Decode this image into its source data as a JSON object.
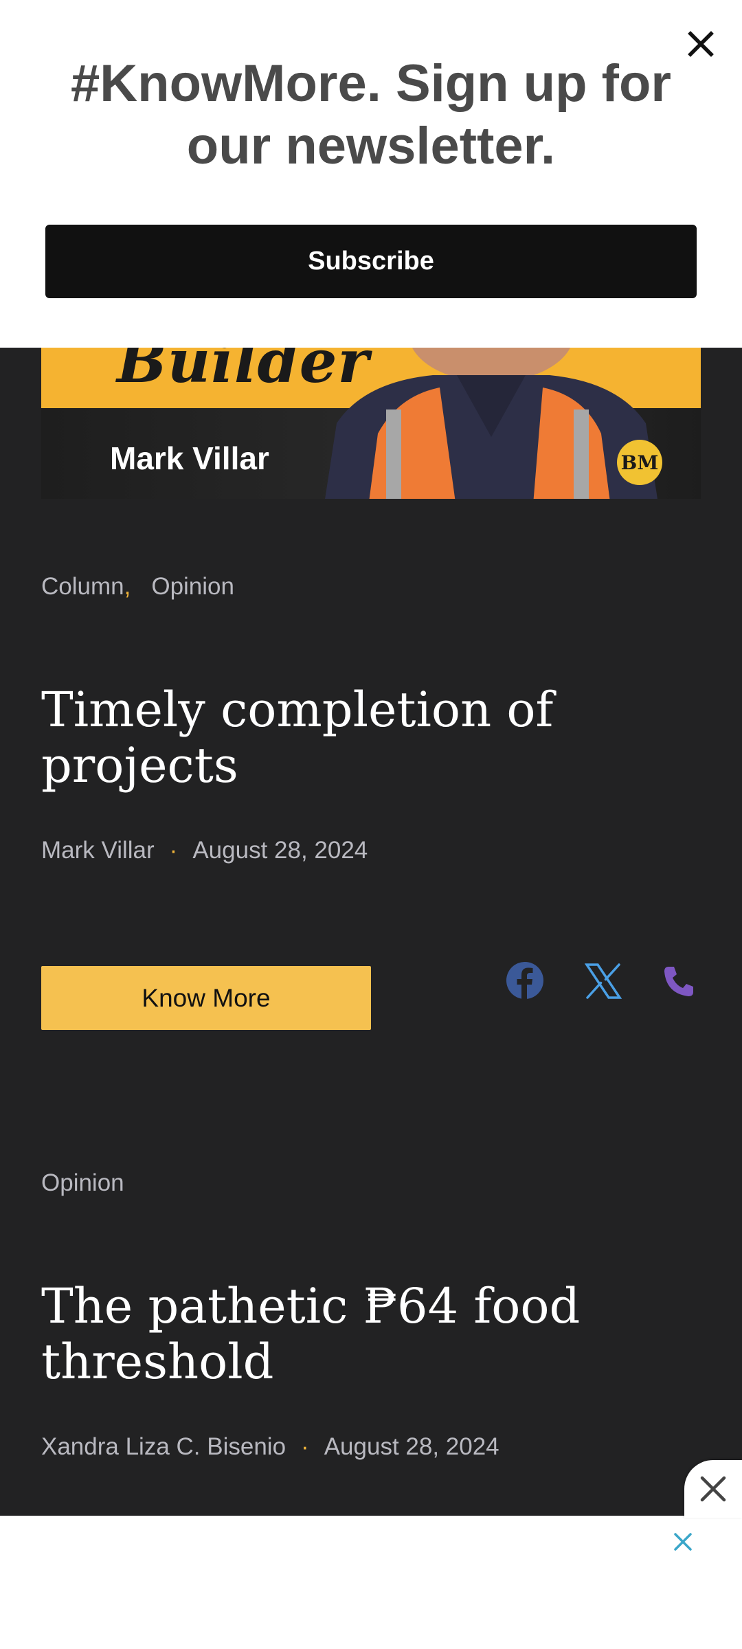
{
  "newsletter": {
    "title": "#KnowMore. Sign up for our newsletter.",
    "subscribe_label": "Subscribe"
  },
  "hero": {
    "builder_text": "Builder",
    "name_text": "Mark Villar",
    "badge_text": "BM"
  },
  "articles": [
    {
      "categories": [
        "Column",
        "Opinion"
      ],
      "title": "Timely completion of projects",
      "author": "Mark Villar",
      "date": "August 28, 2024"
    },
    {
      "categories": [
        "Opinion"
      ],
      "title": "The pathetic ₱64 food threshold",
      "author": "Xandra Liza C. Bisenio",
      "date": "August 28, 2024"
    }
  ],
  "actions": {
    "know_more_label": "Know More"
  },
  "share_icons": [
    "facebook-icon",
    "x-twitter-icon",
    "phone-icon"
  ],
  "colors": {
    "background": "#222223",
    "accent_yellow": "#f5c150",
    "facebook": "#3b5998",
    "twitter": "#4aa0e6",
    "phone": "#7e57c2",
    "ad_close": "#3aa6c9"
  }
}
